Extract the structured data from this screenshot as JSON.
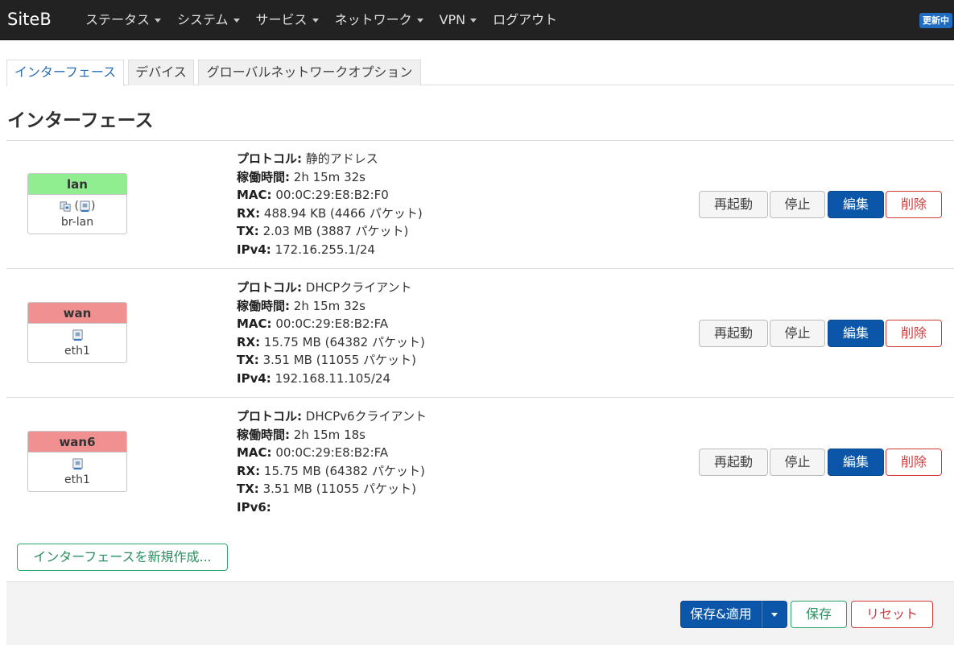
{
  "app": {
    "brand": "SiteB",
    "badge": "更新中"
  },
  "menu": [
    {
      "label": "ステータス",
      "dropdown": true
    },
    {
      "label": "システム",
      "dropdown": true
    },
    {
      "label": "サービス",
      "dropdown": true
    },
    {
      "label": "ネットワーク",
      "dropdown": true
    },
    {
      "label": "VPN",
      "dropdown": true
    },
    {
      "label": "ログアウト",
      "dropdown": false
    }
  ],
  "tabs": [
    {
      "label": "インターフェース",
      "active": true
    },
    {
      "label": "デバイス",
      "active": false
    },
    {
      "label": "グローバルネットワークオプション",
      "active": false
    }
  ],
  "page_title": "インターフェース",
  "labels": {
    "protocol": "プロトコル:",
    "uptime": "稼働時間:",
    "mac": "MAC:",
    "rx": "RX:",
    "tx": "TX:"
  },
  "row_buttons": {
    "restart": "再起動",
    "stop": "停止",
    "edit": "編集",
    "delete": "削除"
  },
  "interfaces": [
    {
      "name": "lan",
      "header_color": "#90ee90",
      "device": "br-lan",
      "icon_extra": "(",
      "icon_extra_close": ")",
      "protocol": "静的アドレス",
      "uptime": "2h 15m 32s",
      "mac": "00:0C:29:E8:B2:F0",
      "rx": "488.94 KB (4466 パケット)",
      "tx": "2.03 MB (3887 パケット)",
      "addr_label": "IPv4:",
      "addr": "172.16.255.1/24"
    },
    {
      "name": "wan",
      "header_color": "#f09090",
      "device": "eth1",
      "protocol": "DHCPクライアント",
      "uptime": "2h 15m 32s",
      "mac": "00:0C:29:E8:B2:FA",
      "rx": "15.75 MB (64382 パケット)",
      "tx": "3.51 MB (11055 パケット)",
      "addr_label": "IPv4:",
      "addr": "192.168.11.105/24"
    },
    {
      "name": "wan6",
      "header_color": "#f09090",
      "device": "eth1",
      "protocol": "DHCPv6クライアント",
      "uptime": "2h 15m 18s",
      "mac": "00:0C:29:E8:B2:FA",
      "rx": "15.75 MB (64382 パケット)",
      "tx": "3.51 MB (11055 パケット)",
      "addr_label": "IPv6:",
      "addr": ""
    }
  ],
  "add_interface": "インターフェースを新規作成...",
  "footer": {
    "save_apply": "保存&適用",
    "save": "保存",
    "reset": "リセット"
  },
  "icons": {
    "network_device": "network-port-icon",
    "bridge": "bridge-icon",
    "dropdown": "caret-down-icon"
  }
}
